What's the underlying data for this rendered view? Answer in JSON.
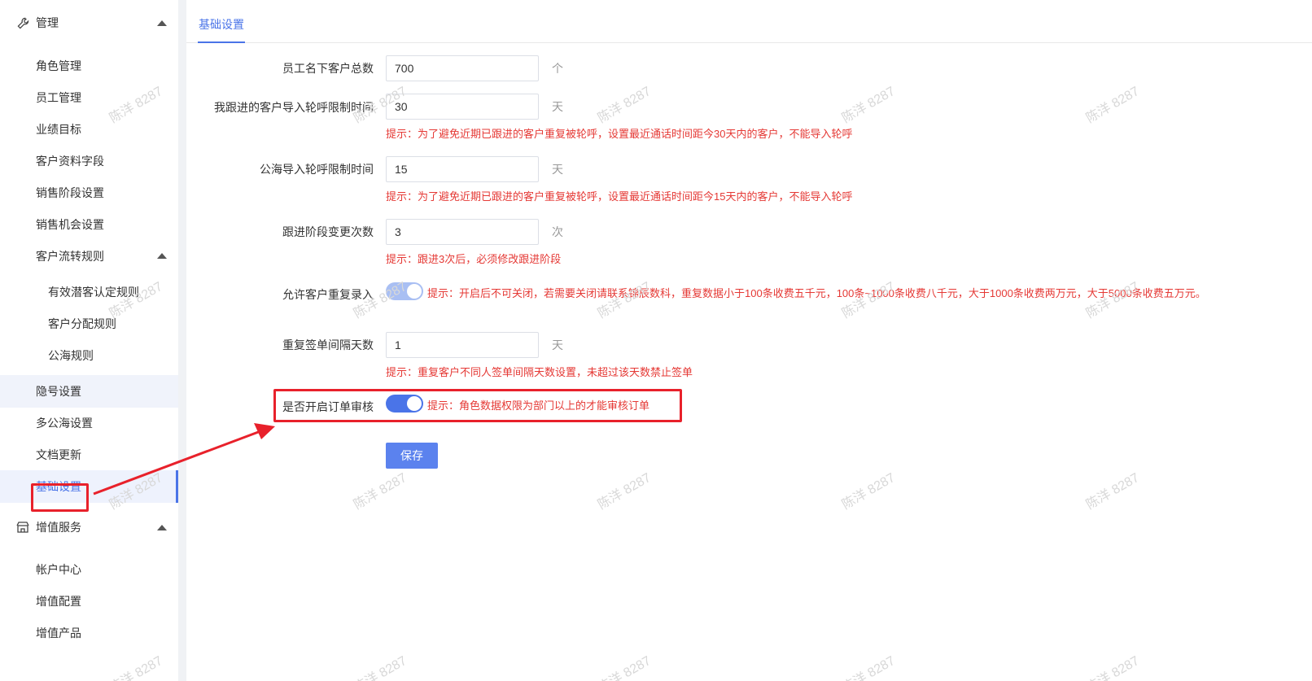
{
  "sidebar": {
    "group_manage": "管理",
    "items_manage": [
      "角色管理",
      "员工管理",
      "业绩目标",
      "客户资料字段",
      "销售阶段设置",
      "销售机会设置"
    ],
    "flow_rules": "客户流转规则",
    "flow_sub": [
      "有效潜客认定规则",
      "客户分配规则",
      "公海规则"
    ],
    "items_more": [
      "隐号设置",
      "多公海设置",
      "文档更新"
    ],
    "active_item": "基础设置",
    "group_value": "增值服务",
    "items_value": [
      "帐户中心",
      "增值配置",
      "增值产品"
    ]
  },
  "tab": {
    "active": "基础设置"
  },
  "form": {
    "f1": {
      "label": "员工名下客户总数",
      "value": "700",
      "unit": "个"
    },
    "f2": {
      "label": "我跟进的客户导入轮呼限制时间",
      "value": "30",
      "unit": "天",
      "hint": "提示：为了避免近期已跟进的客户重复被轮呼，设置最近通话时间距今30天内的客户，不能导入轮呼"
    },
    "f3": {
      "label": "公海导入轮呼限制时间",
      "value": "15",
      "unit": "天",
      "hint": "提示：为了避免近期已跟进的客户重复被轮呼，设置最近通话时间距今15天内的客户，不能导入轮呼"
    },
    "f4": {
      "label": "跟进阶段变更次数",
      "value": "3",
      "unit": "次",
      "hint": "提示：跟进3次后，必须修改跟进阶段"
    },
    "f5": {
      "label": "允许客户重复录入",
      "switch": "on-disabled",
      "hint": "提示：开启后不可关闭，若需要关闭请联系锦辰数科，重复数据小于100条收费五千元，100条~1000条收费八千元，大于1000条收费两万元，大于5000条收费五万元。"
    },
    "f6": {
      "label": "重复签单间隔天数",
      "value": "1",
      "unit": "天",
      "hint": "提示：重复客户不同人签单间隔天数设置，未超过该天数禁止签单"
    },
    "f7": {
      "label": "是否开启订单审核",
      "switch": "on",
      "hint": "提示：角色数据权限为部门以上的才能审核订单"
    },
    "save_label": "保存"
  },
  "watermark": "陈洋 8287",
  "colors": {
    "accent": "#4a74e8",
    "hint": "#e53935",
    "highlight": "#e8212b"
  }
}
